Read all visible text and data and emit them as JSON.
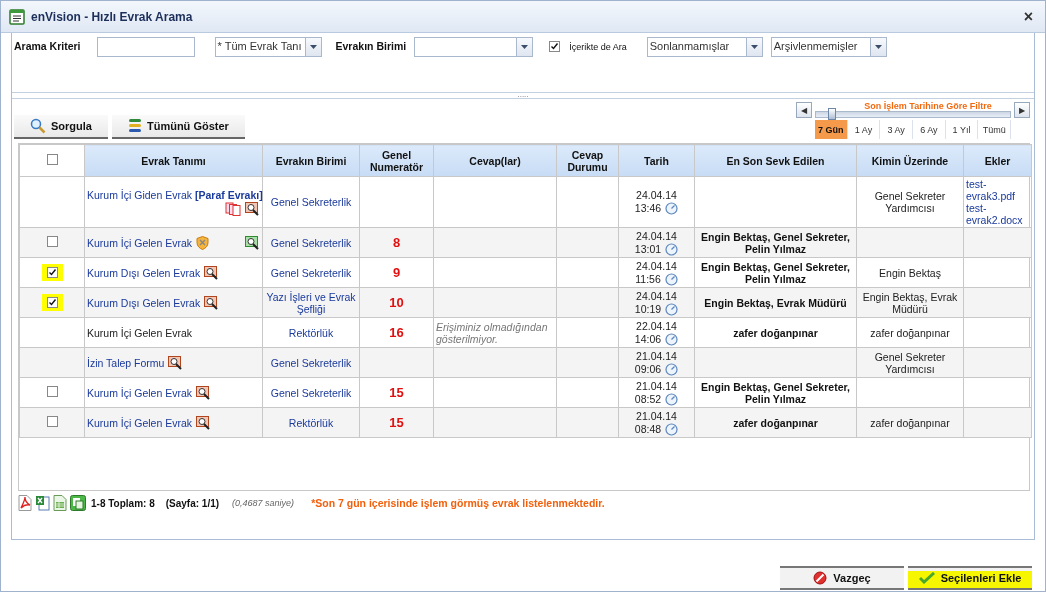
{
  "window": {
    "title": "enVision - Hızlı Evrak Arama",
    "close": "×"
  },
  "filters": {
    "criteria_label": "Arama Kriteri",
    "type_dropdown": "* Tüm Evrak Tanı",
    "unit_label": "Evrakın Birimi",
    "content_search": {
      "label": "İçerikte de Ara",
      "checked": true
    },
    "status_dropdown": "Sonlanmamışlar",
    "archive_dropdown": "Arşivlenmemişler"
  },
  "splitter": ".....",
  "toolbar": [
    {
      "label": "Sorgula",
      "kind": "search"
    },
    {
      "label": "Tümünü Göster",
      "kind": "list"
    }
  ],
  "date_filter": {
    "title": "Son İşlem Tarihine Göre Filtre",
    "level": 0.08,
    "prev": "◀",
    "next": "▶",
    "options": [
      {
        "label": "7 Gün",
        "selected": true
      },
      {
        "label": "1 Ay",
        "selected": false
      },
      {
        "label": "3 Ay",
        "selected": false
      },
      {
        "label": "6 Ay",
        "selected": false
      },
      {
        "label": "1 Yıl",
        "selected": false
      },
      {
        "label": "Tümü",
        "selected": false
      }
    ]
  },
  "table": {
    "select_all": {
      "checked": false
    },
    "columns": [
      "Evrak Tanımı",
      "Evrakın Birimi",
      "Genel Numeratör",
      "Cevap(lar)",
      "Cevap Durumu",
      "Tarih",
      "En Son Sevk Edilen",
      "Kimin Üzerinde",
      "Ekler"
    ],
    "rows": [
      {
        "doc": "Kurum İçi Giden Evrak **[Paraf Evrakı]**",
        "link": true,
        "icons": [
          {
            "kind": "copies"
          },
          {
            "kind": "preview"
          }
        ],
        "unit": "Genel Sekreterlik",
        "date": "24.04.14",
        "time": "13:46",
        "holder": "Genel Sekreter Yardımcısı",
        "attachments": [
          "test-evrak3.pdf",
          "test-evrak2.docx"
        ]
      },
      {
        "checkbox": {
          "checked": false
        },
        "doc": "Kurum İçi Gelen Evrak",
        "link": true,
        "icons": [
          {
            "kind": "shield"
          },
          {
            "kind": "preview-green"
          }
        ],
        "unit": "Genel Sekreterlik",
        "number": "8",
        "date": "24.04.14",
        "time": "13:01",
        "forwarded": "Engin Bektaş, Genel Sekreter, Pelin Yılmaz"
      },
      {
        "checkbox": {
          "checked": true
        },
        "doc": "Kurum Dışı Gelen Evrak",
        "link": true,
        "icons": [
          {
            "kind": "preview"
          }
        ],
        "unit": "Genel Sekreterlik",
        "number": "9",
        "date": "24.04.14",
        "time": "11:56",
        "forwarded": "Engin Bektaş, Genel Sekreter, Pelin Yılmaz",
        "holder": "Engin Bektaş"
      },
      {
        "checkbox": {
          "checked": true
        },
        "doc": "Kurum Dışı Gelen Evrak",
        "link": true,
        "icons": [
          {
            "kind": "preview"
          }
        ],
        "unit": "Yazı İşleri ve Evrak Şefliği",
        "number": "10",
        "date": "24.04.14",
        "time": "10:19",
        "forwarded": "Engin Bektaş, Evrak Müdürü",
        "holder": "Engin Bektaş, Evrak Müdürü"
      },
      {
        "doc": "Kurum İçi Gelen Evrak",
        "link": false,
        "unit": "Rektörlük",
        "number": "16",
        "replies": "Erişiminiz olmadığından gösterilmiyor.",
        "date": "22.04.14",
        "time": "14:06",
        "forwarded": "zafer doğanpınar",
        "holder": "zafer doğanpınar"
      },
      {
        "doc": "İzin Talep Formu",
        "link": true,
        "icons": [
          {
            "kind": "preview"
          }
        ],
        "unit": "Genel Sekreterlik",
        "date": "21.04.14",
        "time": "09:06",
        "holder": "Genel Sekreter Yardımcısı"
      },
      {
        "checkbox": {
          "checked": false
        },
        "doc": "Kurum İçi Gelen Evrak",
        "link": true,
        "icons": [
          {
            "kind": "preview"
          }
        ],
        "unit": "Genel Sekreterlik",
        "number": "15",
        "date": "21.04.14",
        "time": "08:52",
        "forwarded": "Engin Bektaş, Genel Sekreter, Pelin Yılmaz"
      },
      {
        "checkbox": {
          "checked": false
        },
        "doc": "Kurum İçi Gelen Evrak",
        "link": true,
        "icons": [
          {
            "kind": "preview"
          }
        ],
        "unit": "Rektörlük",
        "number": "15",
        "date": "21.04.14",
        "time": "08:48",
        "forwarded": "zafer doğanpınar",
        "holder": "zafer doğanpınar"
      }
    ]
  },
  "footer": {
    "exports": [
      {
        "kind": "pdf"
      },
      {
        "kind": "excel"
      },
      {
        "kind": "sheet"
      },
      {
        "kind": "copy"
      }
    ],
    "range": "1-8 Toplam: 8",
    "page": "(Sayfa: 1/1)",
    "duration": "(0,4687 saniye)",
    "notice": "*Son 7 gün içerisinde işlem görmüş evrak listelenmektedir."
  },
  "actions": [
    {
      "label": "Vazgeç",
      "kind": "cancel",
      "highlighted": false
    },
    {
      "label": "Seçilenleri Ekle",
      "kind": "confirm",
      "highlighted": true
    }
  ]
}
